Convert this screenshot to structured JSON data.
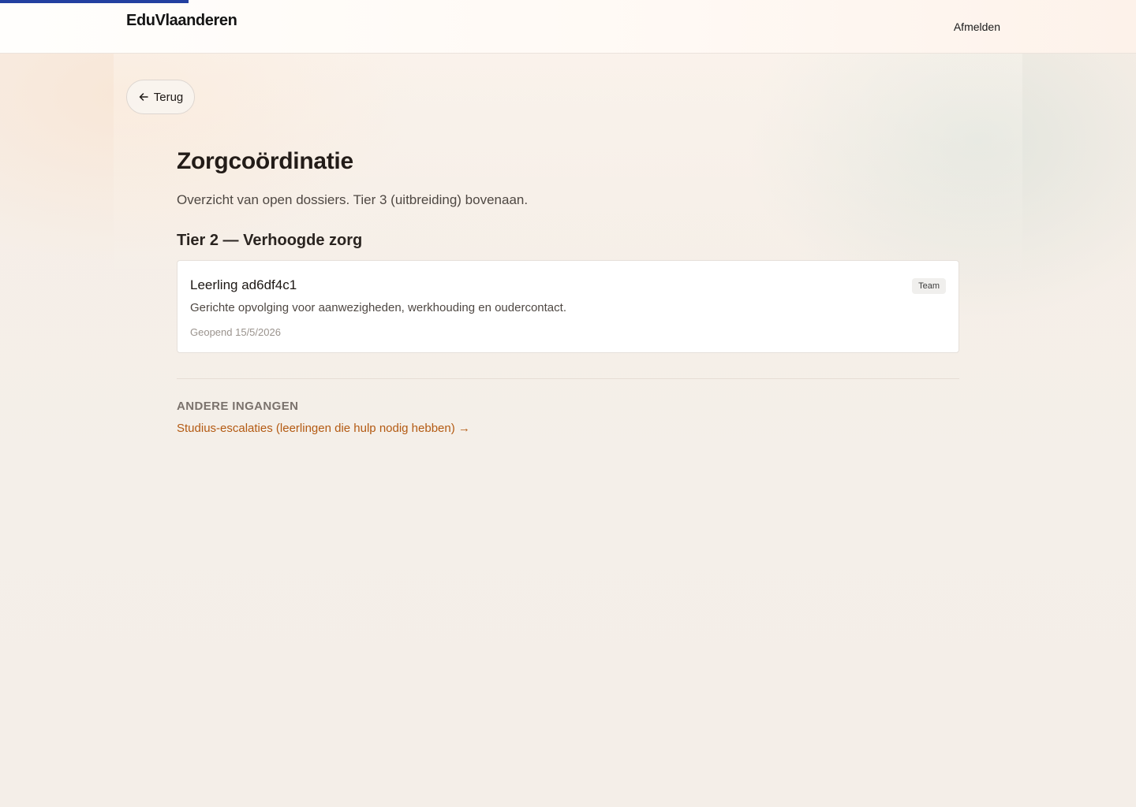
{
  "header": {
    "brand": "EduVlaanderen",
    "logout_label": "Afmelden",
    "progress_fraction": 0.166
  },
  "main": {
    "back_label": "Terug",
    "title": "Zorgcoördinatie",
    "subtitle": "Overzicht van open dossiers. Tier 3 (uitbreiding) bovenaan.",
    "section_title": "Tier 2 — Verhoogde zorg",
    "cards": [
      {
        "title": "Leerling ad6df4c1",
        "badge": "Team",
        "description": "Gerichte opvolging voor aanwezigheden, werkhouding en oudercontact.",
        "opened": "Geopend 15/5/2026"
      }
    ],
    "other_heading": "ANDERE INGANGEN",
    "other_link": "Studius-escalaties (leerlingen die hulp nodig hebben) →"
  },
  "colors": {
    "progress": "#2340a0",
    "link": "#b35a12",
    "background": "#f4efe9"
  },
  "icons": {
    "back": "arrow-left-icon"
  }
}
